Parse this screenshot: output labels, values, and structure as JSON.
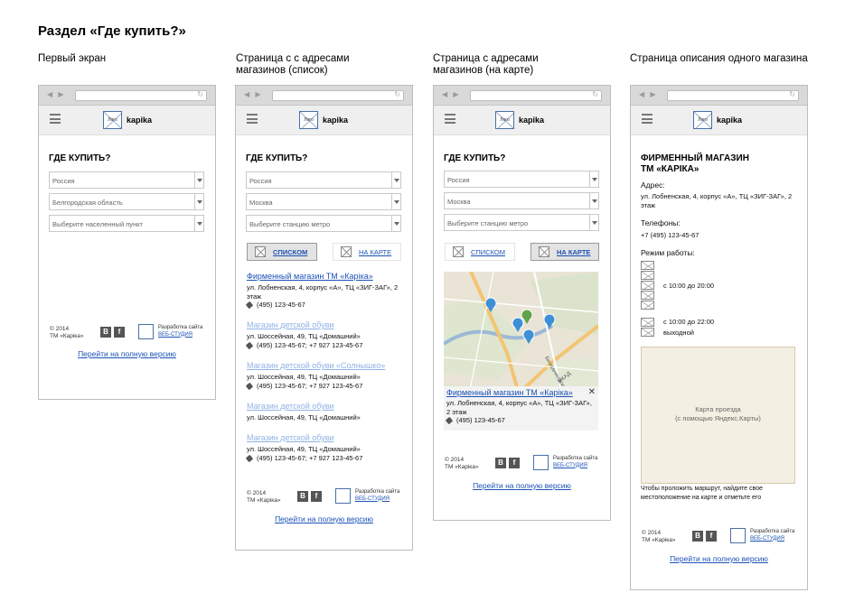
{
  "page_title": "Раздел «Где купить?»",
  "columns": [
    {
      "title": "Первый экран"
    },
    {
      "title": "Страница с с адресами магазинов (список)"
    },
    {
      "title": "Страница с адресами магазинов (на карте)"
    },
    {
      "title": "Страница описания одного магазина"
    }
  ],
  "common": {
    "logo_text": "Лого",
    "brand": "kapika",
    "section_heading": "ГДЕ КУПИТЬ?",
    "copyright_line1": "© 2014",
    "copyright_line2": "ТМ «Карiка»",
    "social_vk": "В",
    "social_fb": "f",
    "dev_label": "Разработка сайта",
    "dev_link": "ВЕБ-СТУДИЯ",
    "full_version_link": "Перейти на полную версию"
  },
  "screen1": {
    "selects": [
      "Россия",
      "Белгородская область",
      "Выберите населенный пункт"
    ]
  },
  "screen2": {
    "selects": [
      "Россия",
      "Москва",
      "Выберите станцию метро"
    ],
    "toggle_list": "СПИСКОМ",
    "toggle_map": "НА КАРТЕ",
    "stores": [
      {
        "name": "Фирменный магазин ТМ «Карiка»",
        "address": "ул. Лобненская, 4, корпус «А», ТЦ «ЗИГ-ЗАГ», 2 этаж",
        "phone": "(495) 123-45-67"
      },
      {
        "name": "Магазин детской обуви",
        "address": "ул. Шоссейная, 49, ТЦ «Домашний»",
        "phone": "(495) 123-45-67;  +7 927 123-45-67"
      },
      {
        "name": "Магазин детской обуви «Солнышко»",
        "address": "ул. Шоссейная, 49, ТЦ «Домашний»",
        "phone": "(495) 123-45-67;  +7 927 123-45-67"
      },
      {
        "name": "Магазин детской обуви",
        "address": "ул. Шоссейная, 49, ТЦ «Домашний»",
        "phone": ""
      },
      {
        "name": "Магазин детской обуви",
        "address": "ул. Шоссейная, 49, ТЦ «Домашний»",
        "phone": "(495) 123-45-67;  +7 927 123-45-67"
      }
    ]
  },
  "screen3": {
    "selects": [
      "Россия",
      "Москва",
      "Выберите станцию метро"
    ],
    "toggle_list": "СПИСКОМ",
    "toggle_map": "НА КАРТЕ",
    "map_labels": [
      "Бескудниковский б-р",
      "МКАД"
    ],
    "popup": {
      "name": "Фирменный магазин ТМ «Карiка»",
      "address": "ул. Лобненская, 4, корпус «А», ТЦ «ЗИГ-ЗАГ», 2 этаж",
      "phone": "(495) 123-45-67",
      "close": "✕"
    }
  },
  "screen4": {
    "store_title_line1": "ФИРМЕННЫЙ МАГАЗИН",
    "store_title_line2": "ТМ «КАРIКА»",
    "address_label": "Адрес:",
    "address": "ул. Лобненская, 4, корпус «А», ТЦ «ЗИГ-ЗАГ», 2 этаж",
    "phones_label": "Телефоны:",
    "phone": "+7 (495) 123-45-67",
    "hours_label": "Режим работы:",
    "hours_weekdays": "с 10:00 до 20:00",
    "hours_weekend": "с 10:00 до 22:00",
    "day_off": "выходной",
    "map_placeholder_line1": "Карта проезда",
    "map_placeholder_line2": "(с помощью Яндекс.Карты)",
    "route_hint": "Чтобы проложить маршрут, найдите свое местоположение на карте и отметьте его"
  }
}
